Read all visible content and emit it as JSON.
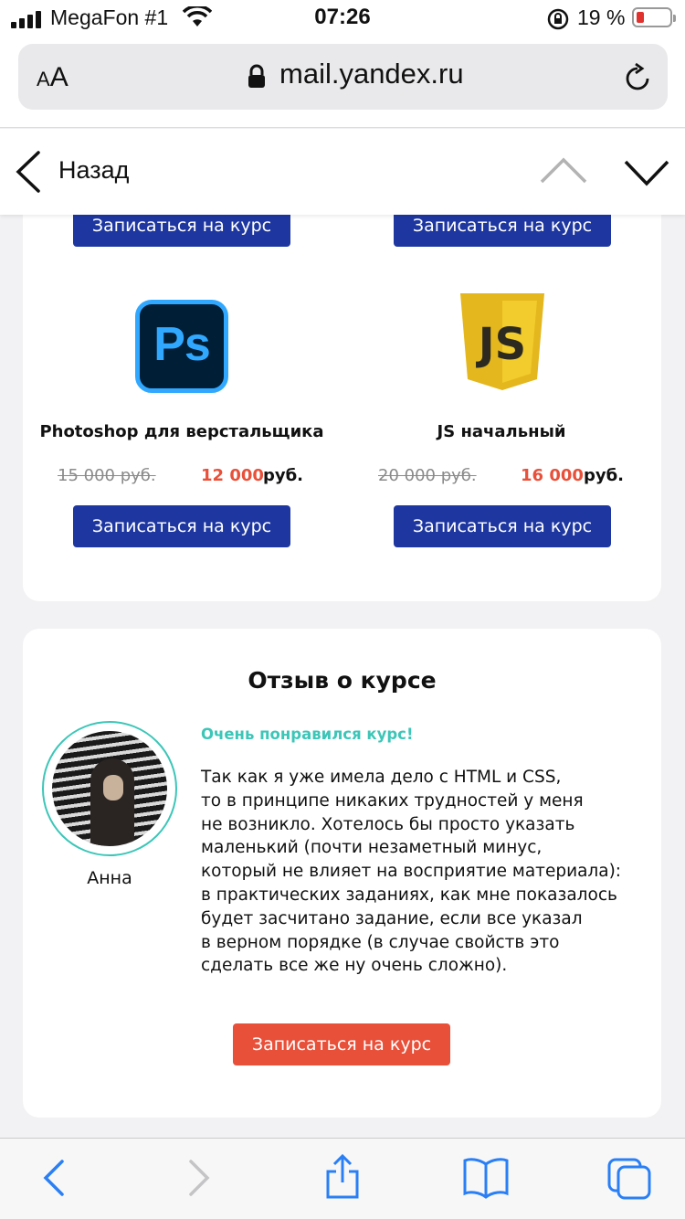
{
  "status": {
    "carrier": "MegaFon #1",
    "time": "07:26",
    "battery": "19 %",
    "battery_level": 0.19
  },
  "browser": {
    "aa_small": "A",
    "aa_large": "A",
    "url": "mail.yandex.ru"
  },
  "nav": {
    "back": "Назад"
  },
  "courses": {
    "top_buttons": [
      "Записаться на курс",
      "Записаться на курс"
    ],
    "items": [
      {
        "logo_text": "Ps",
        "title": "Photoshop для верстальщика",
        "old_price": "15 000 руб.",
        "new_price": "12 000",
        "currency": "руб.",
        "button": "Записаться на курс"
      },
      {
        "logo_text": "JS",
        "title": "JS начальный",
        "old_price": "20 000 руб.",
        "new_price": "16 000",
        "currency": "руб.",
        "button": "Записаться на курс"
      }
    ]
  },
  "review": {
    "heading": "Отзыв о курсе",
    "name": "Анна",
    "lead": "Очень понравился курс!",
    "text": "Так как я уже имела дело с HTML и CSS,\nто в принципе никаких трудностей у меня\nне возникло. Хотелось бы просто указать\nмаленький (почти незаметный минус,\nкоторый не влияет на восприятие материала):\nв практических заданиях, как мне показалось\nбудет засчитано задание, если все указал\nв верном порядке (в случае свойств это\nсделать все же ну очень сложно).",
    "cta": "Записаться на курс"
  },
  "colors": {
    "primary_button": "#1e37a0",
    "accent": "#e8503a",
    "teal": "#3cc6b8",
    "ios_blue": "#2a7ff5"
  },
  "icons": [
    "signal-icon",
    "wifi-icon",
    "rotation-lock-icon",
    "battery-icon",
    "padlock-icon",
    "reload-icon",
    "back-chevron-icon",
    "chevron-up-icon",
    "chevron-down-icon",
    "safari-back-icon",
    "safari-forward-icon",
    "share-icon",
    "bookmarks-icon",
    "tabs-icon"
  ]
}
